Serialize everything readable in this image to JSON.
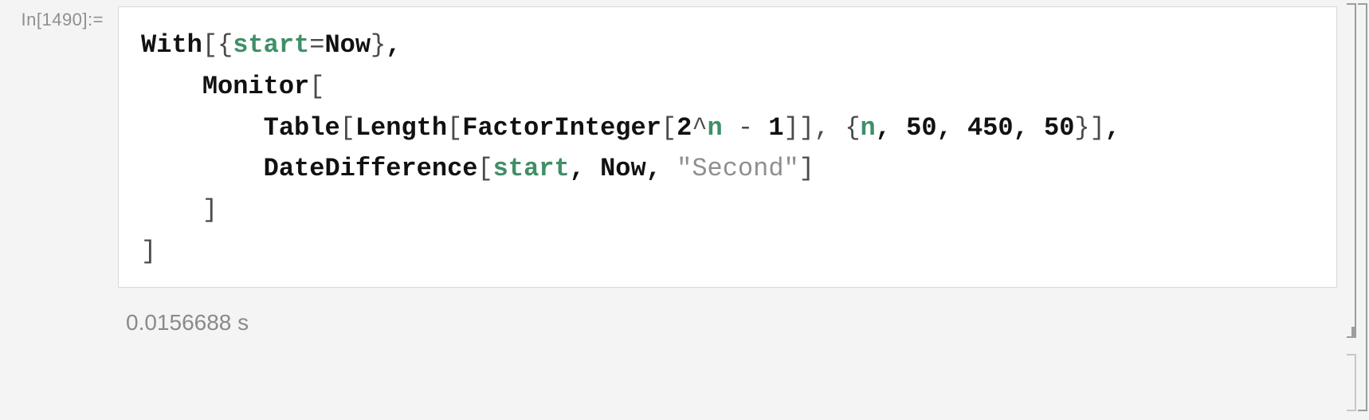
{
  "input": {
    "label": "In[1490]:=",
    "code": {
      "line1": {
        "with": "With",
        "start": "start",
        "eq": "=",
        "now": "Now"
      },
      "line2": {
        "monitor": "Monitor"
      },
      "line3": {
        "table": "Table",
        "length": "Length",
        "factor": "FactorInteger",
        "base": "2",
        "caret": "^",
        "nvar": "n",
        "minus": " - ",
        "one": "1",
        "iter_n": "n",
        "iter_a": "50",
        "iter_b": "450",
        "iter_c": "50"
      },
      "line4": {
        "dd": "DateDifference",
        "start": "start",
        "now": "Now",
        "unit": "\"Second\""
      }
    }
  },
  "monitor": {
    "value": "0.0156688",
    "unit_space": " ",
    "unit": "s"
  }
}
